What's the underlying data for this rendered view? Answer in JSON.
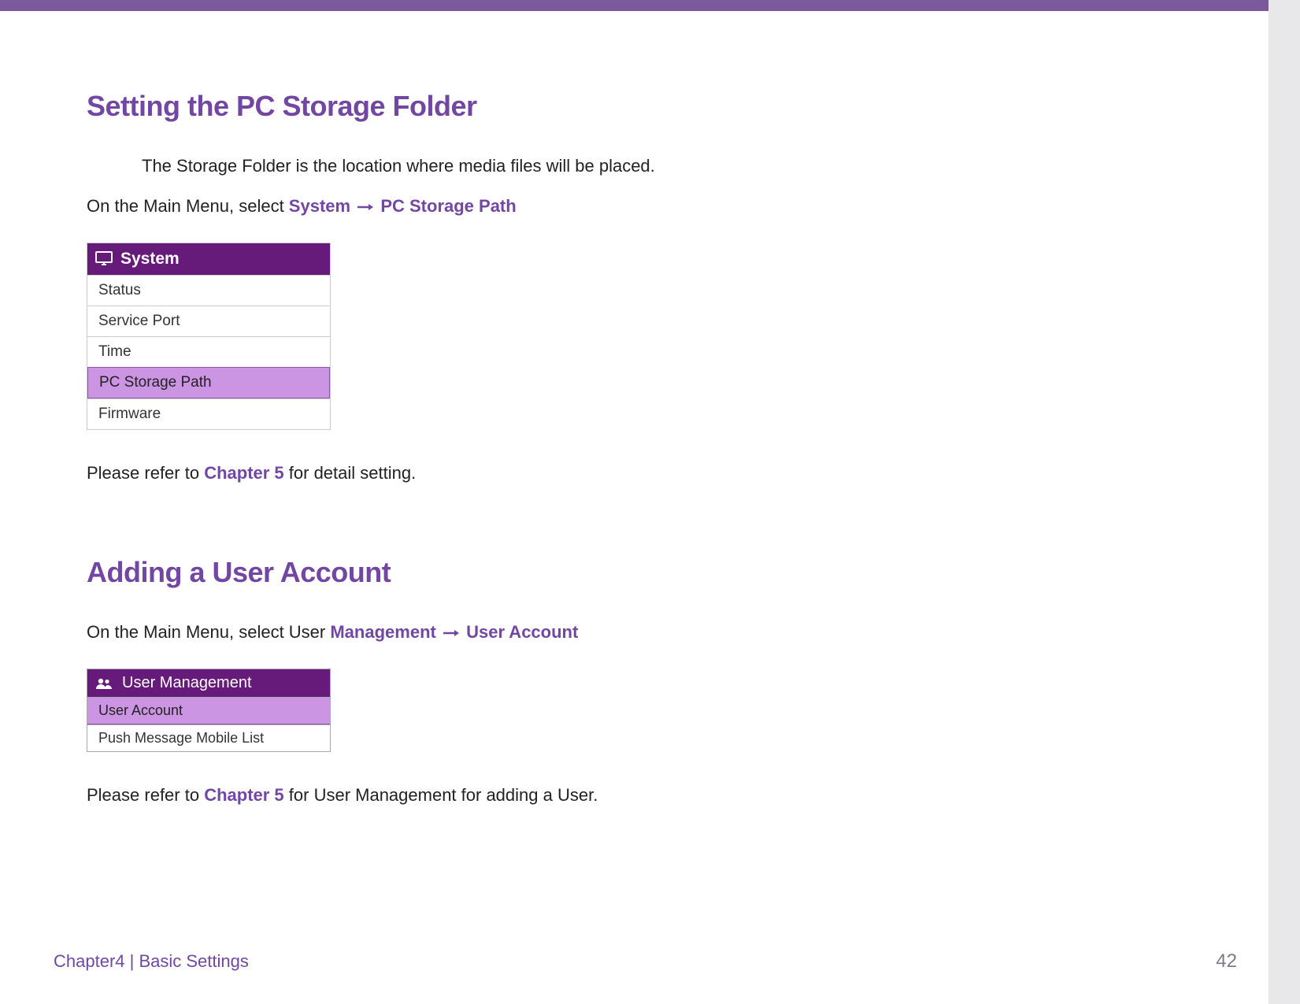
{
  "section1": {
    "heading": "Setting the PC Storage Folder",
    "intro": "The Storage Folder is the location where media files will be placed.",
    "nav_prefix": "On the Main Menu, select ",
    "nav_link1": "System",
    "nav_link2": "PC Storage Path",
    "menu_title": "System",
    "menu_items": [
      "Status",
      "Service Port",
      "Time",
      "PC Storage Path",
      "Firmware"
    ],
    "refer_prefix": "Please refer to ",
    "refer_link": "Chapter 5",
    "refer_suffix": " for detail setting."
  },
  "section2": {
    "heading": "Adding a User Account",
    "nav_prefix": "On the Main Menu, select User ",
    "nav_link1": "Management",
    "nav_link2": "User Account",
    "menu_title": "User Management",
    "menu_items": [
      "User Account",
      "Push Message Mobile List"
    ],
    "refer_prefix": "Please refer to ",
    "refer_link": "Chapter 5",
    "refer_suffix": " for User Management for adding a User."
  },
  "footer": {
    "chapter": "Chapter4  |  Basic Settings",
    "page": "42"
  }
}
